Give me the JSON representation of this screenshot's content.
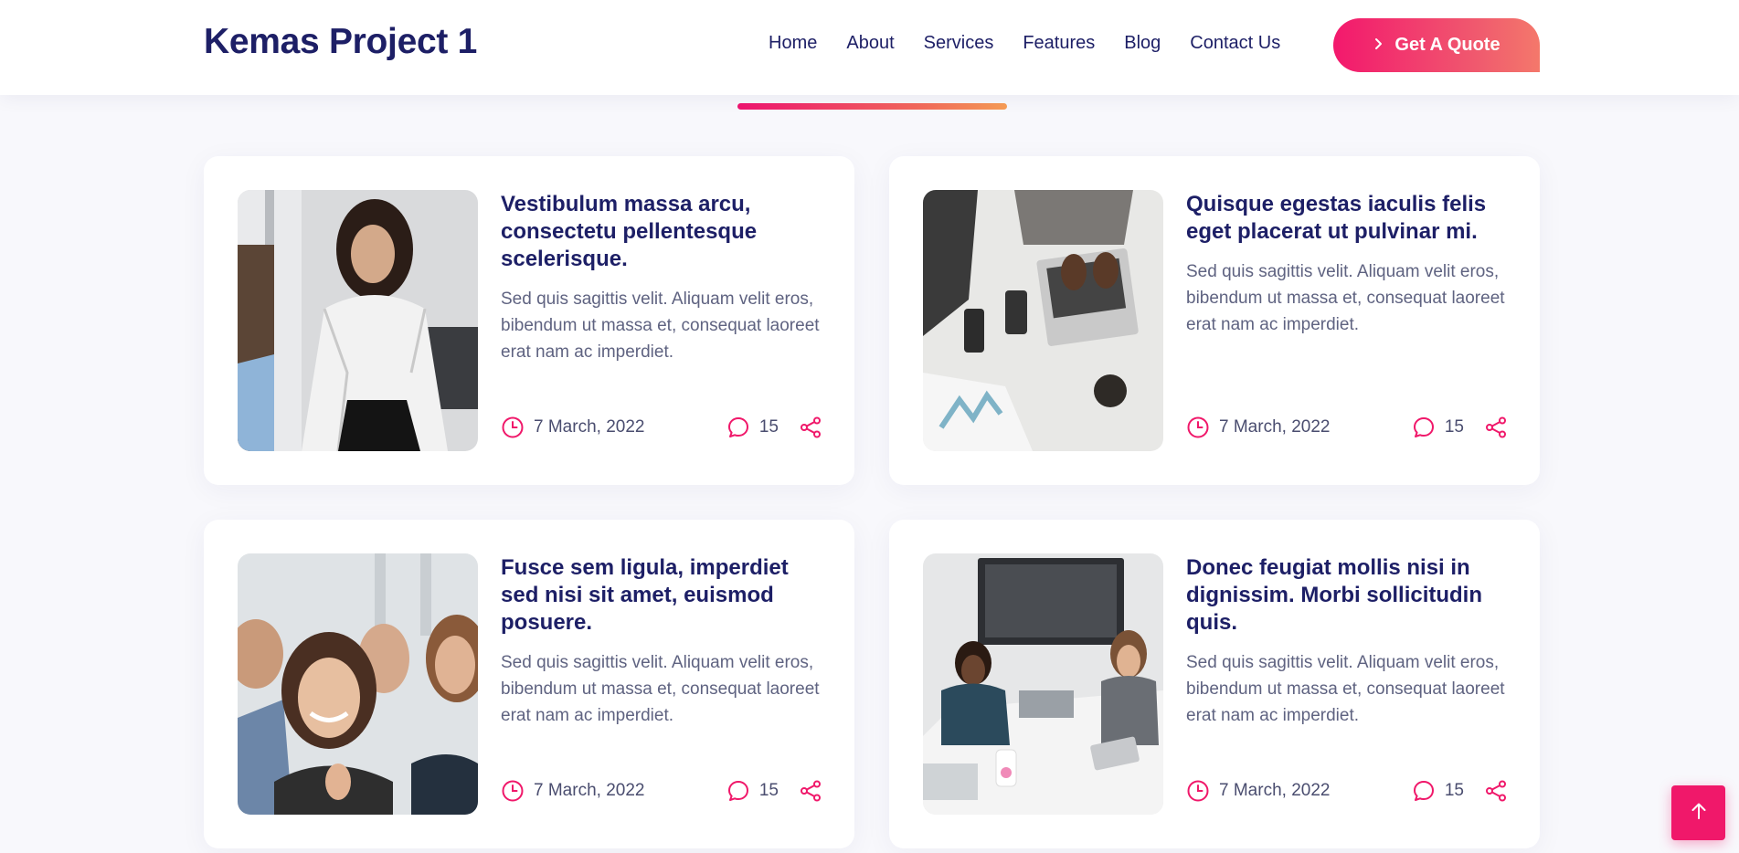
{
  "brand": "Kemas Project 1",
  "nav": {
    "items": [
      "Home",
      "About",
      "Services",
      "Features",
      "Blog",
      "Contact Us"
    ],
    "cta_label": "Get A Quote"
  },
  "colors": {
    "primary": "#1d1f66",
    "accent": "#f0186a",
    "text_muted": "#5f6381"
  },
  "posts": [
    {
      "title": "Vestibulum massa arcu, consectetu pellentesque scelerisque.",
      "excerpt": "Sed quis sagittis velit. Aliquam velit eros, bibendum ut massa et, consequat laoreet erat nam ac imperdiet.",
      "date": "7 March, 2022",
      "comments": "15",
      "image": "woman-at-office-desk-photo"
    },
    {
      "title": "Quisque egestas iaculis felis eget placerat ut pulvinar mi.",
      "excerpt": "Sed quis sagittis velit. Aliquam velit eros, bibendum ut massa et, consequat laoreet erat nam ac imperdiet.",
      "date": "7 March, 2022",
      "comments": "15",
      "image": "laptop-top-view-photo"
    },
    {
      "title": "Fusce sem ligula, imperdiet sed nisi sit amet, euismod posuere.",
      "excerpt": "Sed quis sagittis velit. Aliquam velit eros, bibendum ut massa et, consequat laoreet erat nam ac imperdiet.",
      "date": "7 March, 2022",
      "comments": "15",
      "image": "team-thumbs-up-photo"
    },
    {
      "title": "Donec feugiat mollis nisi in dignissim. Morbi sollicitudin quis.",
      "excerpt": "Sed quis sagittis velit. Aliquam velit eros, bibendum ut massa et, consequat laoreet erat nam ac imperdiet.",
      "date": "7 March, 2022",
      "comments": "15",
      "image": "meeting-room-photo"
    }
  ],
  "icons": {
    "date": "clock-icon",
    "comments": "comment-icon",
    "share": "share-icon",
    "scroll_top": "arrow-up-icon",
    "cta": "chevron-right-icon"
  }
}
